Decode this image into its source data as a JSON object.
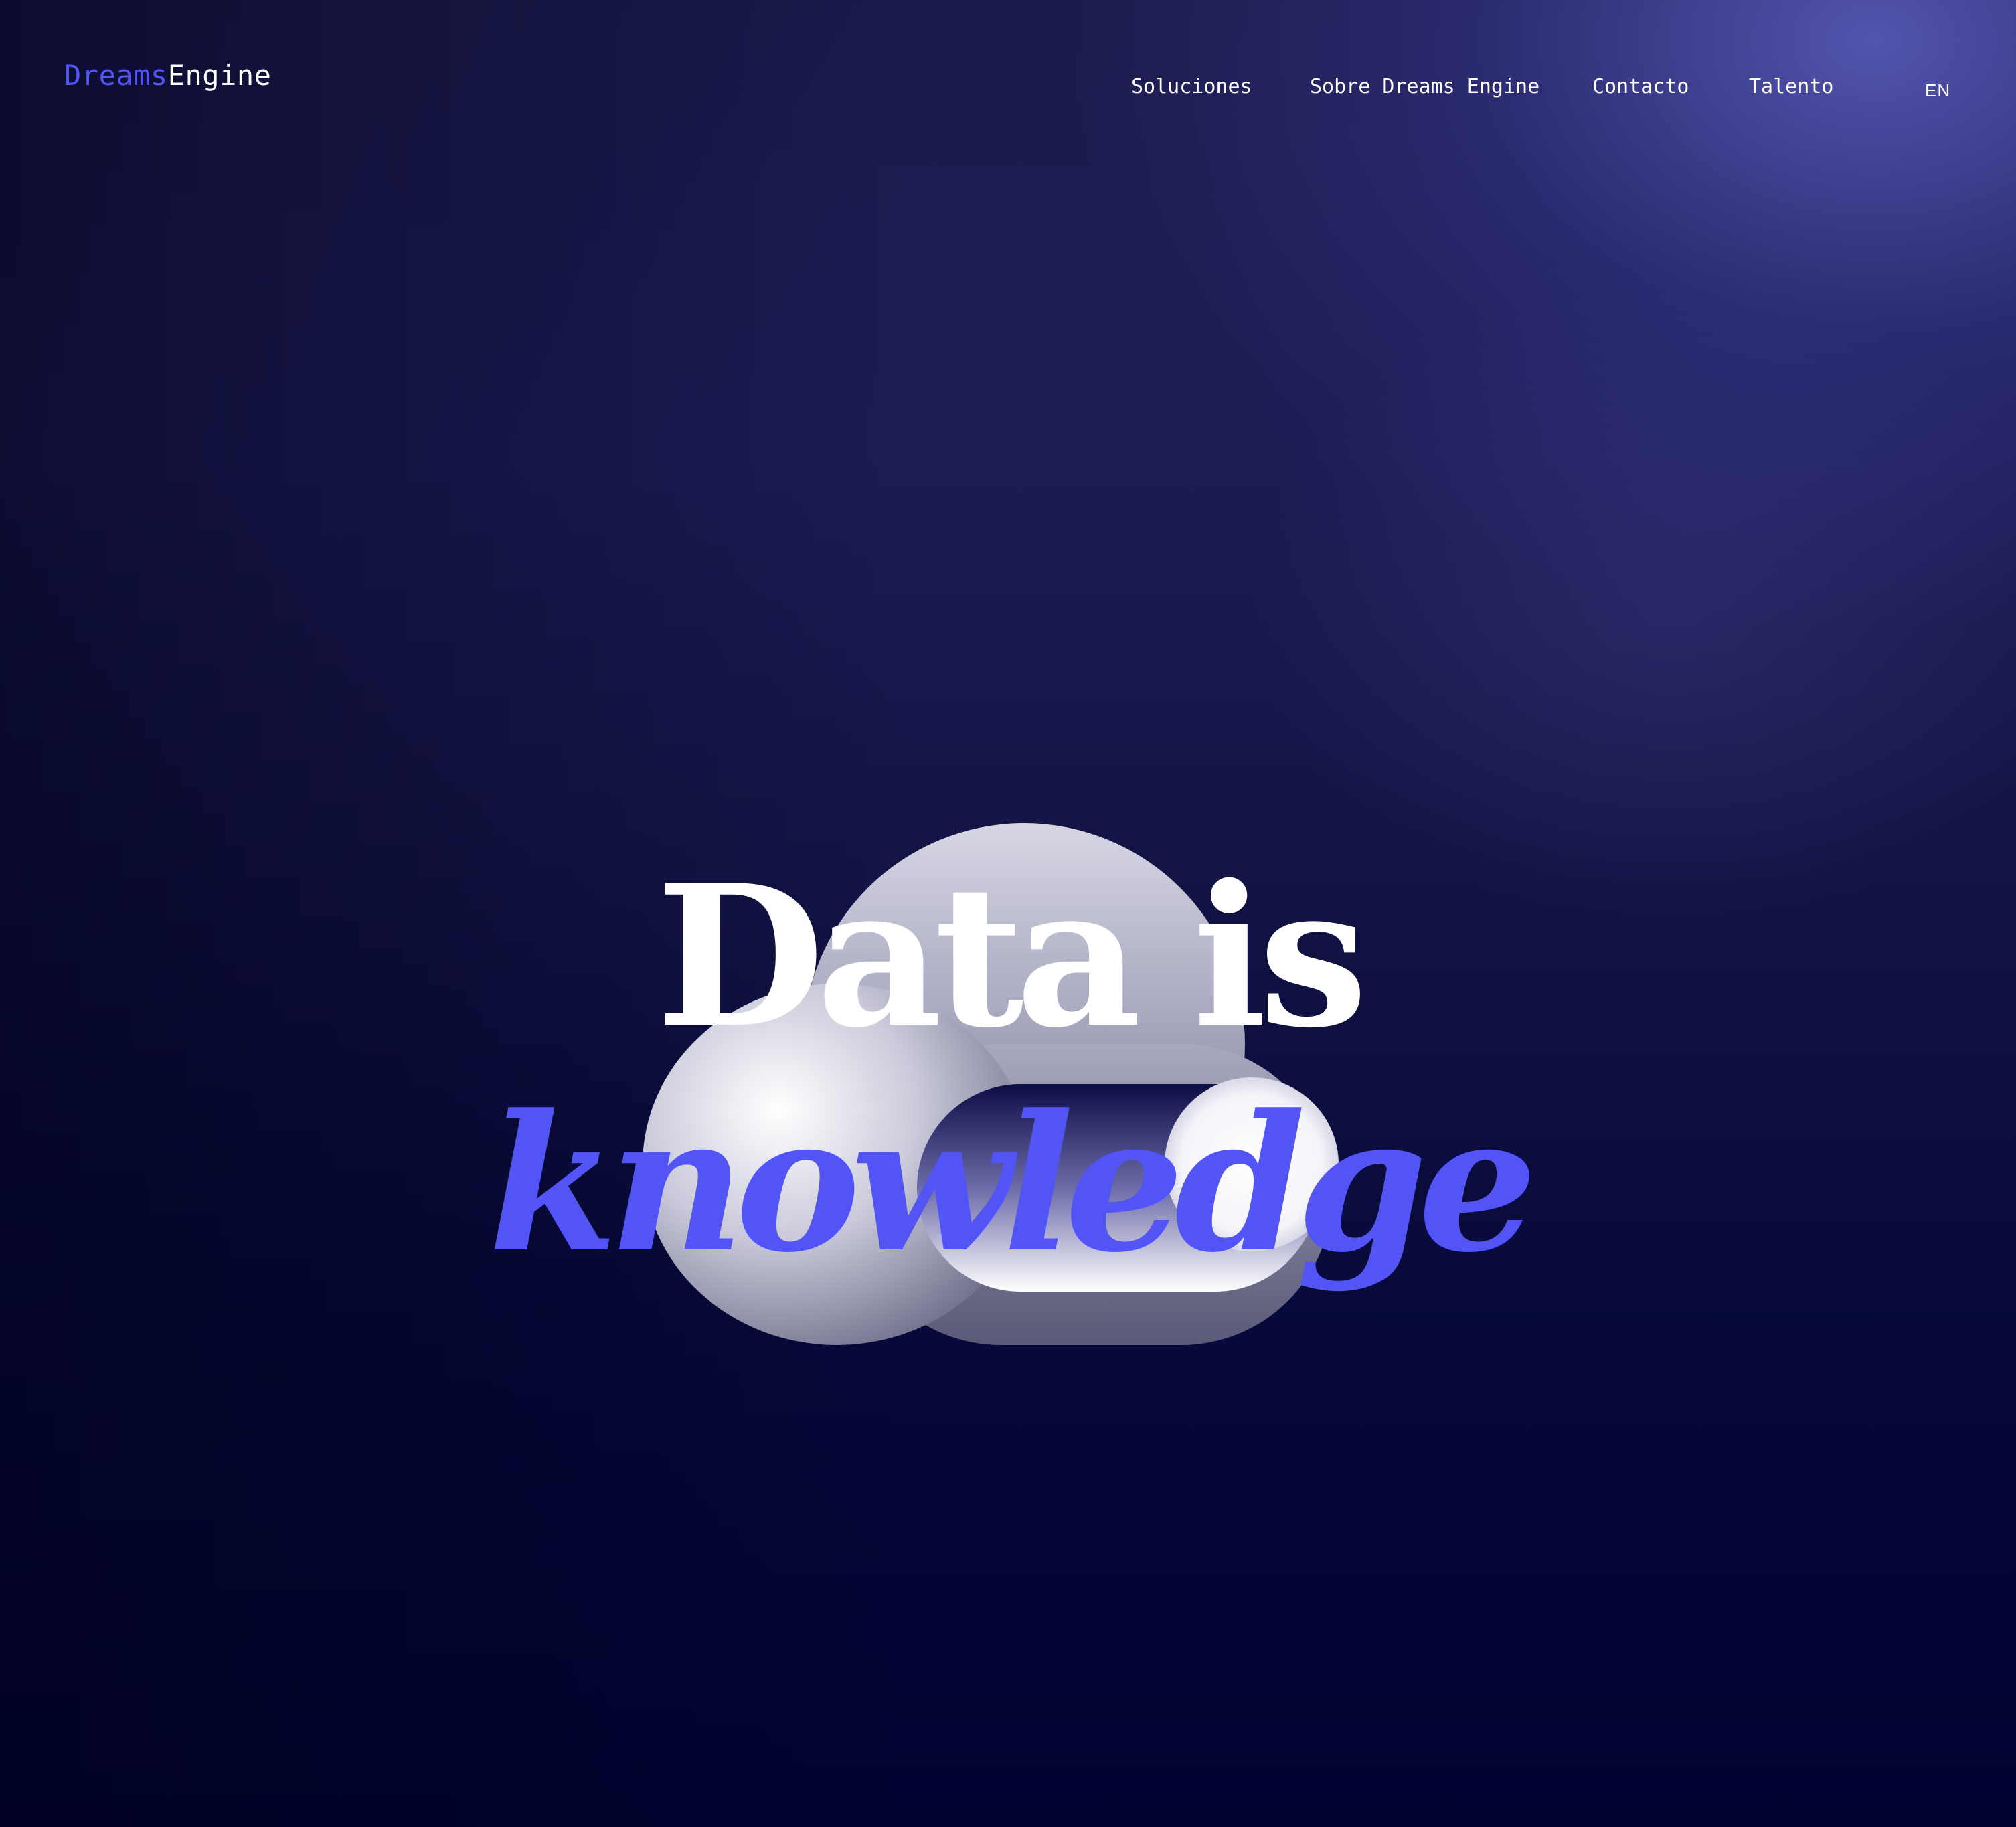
{
  "brand": {
    "part1": "Dreams",
    "part2": "Engine",
    "accent_color": "#5254f5"
  },
  "nav": {
    "items": [
      "Soluciones",
      "Sobre Dreams Engine",
      "Contacto",
      "Talento"
    ],
    "language": "EN"
  },
  "hero": {
    "line1": "Data is",
    "line2": "knowledge",
    "illustration": "cloud-icon"
  }
}
